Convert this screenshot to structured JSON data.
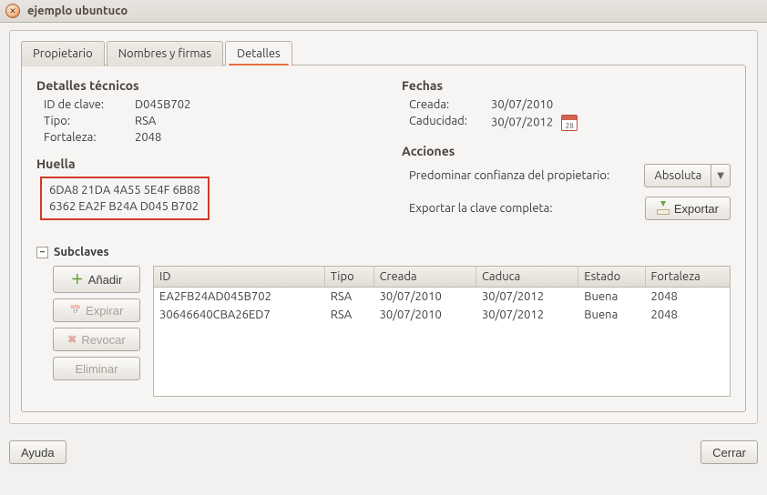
{
  "window": {
    "title": "ejemplo ubuntuco"
  },
  "tabs": {
    "owner": "Propietario",
    "names": "Nombres y firmas",
    "details": "Detalles"
  },
  "tech": {
    "heading": "Detalles técnicos",
    "key_id_label": "ID de clave:",
    "key_id": "D045B702",
    "type_label": "Tipo:",
    "type": "RSA",
    "strength_label": "Fortaleza:",
    "strength": "2048"
  },
  "fingerprint": {
    "heading": "Huella",
    "line1": "6DA8 21DA 4A55 5E4F 6B88",
    "line2": "6362 EA2F B24A D045 B702"
  },
  "dates": {
    "heading": "Fechas",
    "created_label": "Creada:",
    "created": "30/07/2010",
    "expires_label": "Caducidad:",
    "expires": "30/07/2012"
  },
  "actions": {
    "heading": "Acciones",
    "trust_label": "Predominar confianza del propietario:",
    "trust_value": "Absoluta",
    "export_label": "Exportar la clave completa:",
    "export_btn": "Exportar"
  },
  "subkeys": {
    "heading": "Subclaves",
    "btn_add": "Añadir",
    "btn_expire": "Expirar",
    "btn_revoke": "Revocar",
    "btn_delete": "Eliminar",
    "columns": {
      "id": "ID",
      "type": "Tipo",
      "created": "Creada",
      "expires": "Caduca",
      "state": "Estado",
      "strength": "Fortaleza"
    },
    "rows": [
      {
        "id": "EA2FB24AD045B702",
        "type": "RSA",
        "created": "30/07/2010",
        "expires": "30/07/2012",
        "state": "Buena",
        "strength": "2048"
      },
      {
        "id": "30646640CBA26ED7",
        "type": "RSA",
        "created": "30/07/2010",
        "expires": "30/07/2012",
        "state": "Buena",
        "strength": "2048"
      }
    ]
  },
  "bottom": {
    "help": "Ayuda",
    "close": "Cerrar"
  }
}
